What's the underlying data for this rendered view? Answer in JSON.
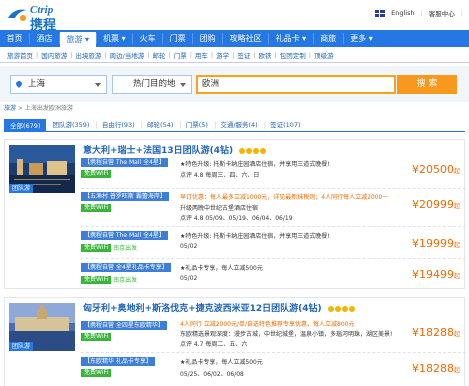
{
  "logo": {
    "en": "Ctrip",
    "cn": "携程"
  },
  "top_links": {
    "language": "English",
    "service": "客服中心"
  },
  "nav": [
    {
      "label": "首页",
      "active": false
    },
    {
      "label": "酒店",
      "active": false
    },
    {
      "label": "旅游 ▾",
      "active": true
    },
    {
      "label": "机票 ▾",
      "active": false
    },
    {
      "label": "火车",
      "active": false
    },
    {
      "label": "门票",
      "active": false
    },
    {
      "label": "团购",
      "active": false
    },
    {
      "label": "攻略社区",
      "active": false
    },
    {
      "label": "礼品卡 ▾",
      "active": false
    },
    {
      "label": "商旅",
      "active": false
    },
    {
      "label": "更多 ▾",
      "active": false
    }
  ],
  "subnav": [
    "旅游首页",
    "国内旅游",
    "出境旅游",
    "周边/当地游",
    "邮轮",
    "门票",
    "用车",
    "游学",
    "签证",
    "欧铁",
    "包团定制",
    "顶级游"
  ],
  "search": {
    "departure": "上海",
    "destination_placeholder": "热门目的地",
    "keyword": "欧洲",
    "button": "搜 索"
  },
  "breadcrumb": {
    "home": "旅游",
    "sep": " > ",
    "current": "上海出发欧洲旅游"
  },
  "tabs": [
    {
      "label": "全部(679)",
      "active": true
    },
    {
      "label": "团队游(359)",
      "active": false
    },
    {
      "label": "自由行(93)",
      "active": false
    },
    {
      "label": "邮轮(54)",
      "active": false
    },
    {
      "label": "门票(5)",
      "active": false
    },
    {
      "label": "交通/服务(4)",
      "active": false
    },
    {
      "label": "签证(107)",
      "active": false
    }
  ],
  "products": [
    {
      "title": "意大利+瑞士+法国13日团队游(4钻)",
      "tag": "团队游",
      "rows": [
        {
          "badge": "【携程自营 The Mall 全4星】",
          "wifi": "免费WiFi",
          "green": "",
          "line1": "★特色升级: 托斯卡纳庄园酒店住宿，并享用三道式晚餐!",
          "line1_orange": false,
          "line2": "点评 4.8    每周三、四、六、日",
          "line3": "",
          "price": "20500",
          "price_suffix": "起"
        },
        {
          "badge": "【五渔村 普罗旺斯 霸蕾海岸】",
          "wifi": "免费WiFi",
          "green": "",
          "line1": "早订优惠：每人最多立减1000元，详见最新抹税则；4人同行每人立减2000一",
          "line1_orange": true,
          "line2": "升级两晚中世纪古堡酒店住宿",
          "line3": "点评 4.8    05/09、05/19、06/04、06/19",
          "price": "20999",
          "price_suffix": "起"
        },
        {
          "badge": "【携程自营 The Mall 全4星】",
          "wifi": "免费WiFi",
          "green": "南京出发",
          "line1": "★特色升级: 托斯卡纳庄园酒店住宿，并享用三道式晚餐!",
          "line1_orange": false,
          "line2": "05/02",
          "line3": "",
          "price": "19999",
          "price_suffix": "起"
        },
        {
          "badge": "【携程自营 全4星礼品卡专享】",
          "wifi": "免费WiFi",
          "green": "南京出发",
          "line1": "★礼品卡专享，每人立减500元",
          "line1_orange": false,
          "line2": "05/02",
          "line3": "",
          "price": "19499",
          "price_suffix": "起"
        }
      ]
    },
    {
      "title": "匈牙利+奥地利+斯洛伐克+捷克波西米亚12日团队游(4钻)",
      "tag": "团队游",
      "rows": [
        {
          "badge": "【携程自营 全四星东欧精华】",
          "wifi": "免费WiFi",
          "green": "",
          "line1": "4人同行 立减2000元/单/自选特色推荐专享优惠，每人立减800元",
          "line1_orange": true,
          "line2": "东欧精选景观深度：漫步古城，中世纪城堡，温泉小镇，多瑙河明珠，湖区美景!",
          "line3": "点评 4.7    每周二、五、六",
          "price": "18288",
          "price_suffix": "起"
        },
        {
          "badge": "【东欧精华 礼品卡专享】",
          "wifi": "免费WiFi",
          "green": "",
          "line1": "★礼品卡专享，每人立减500元",
          "line1_orange": false,
          "line2": "05/25、06/02、06/08",
          "line3": "",
          "price": "18288",
          "price_suffix": "起"
        }
      ]
    }
  ],
  "colors": {
    "primary": "#2577e3",
    "orange": "#f06a00",
    "green": "#3bb43c",
    "search_btn": "#f8981d"
  },
  "icons": [
    "ctrip-logo-icon",
    "uk-flag-icon",
    "location-pin-icon",
    "dropdown-caret-icon",
    "star-icon",
    "heart-icon"
  ]
}
